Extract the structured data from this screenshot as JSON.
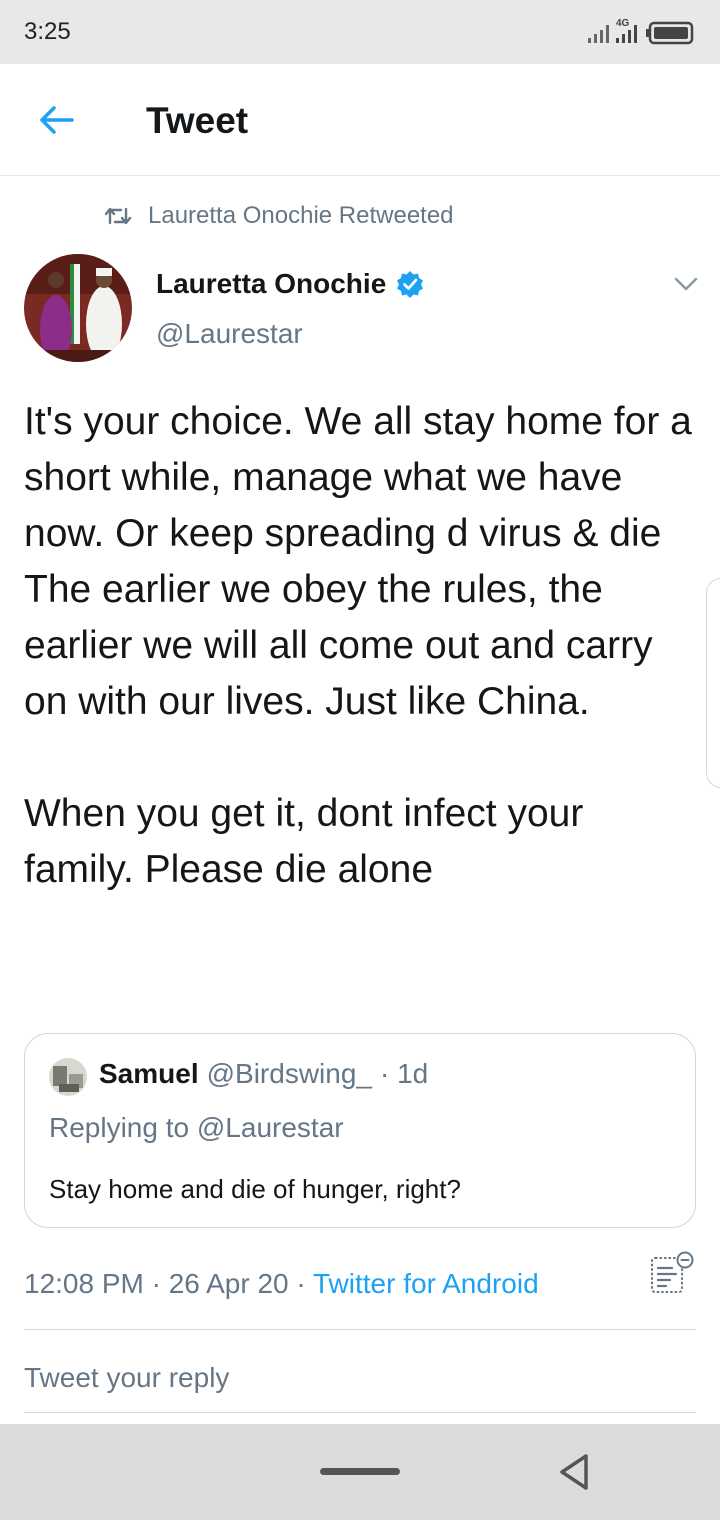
{
  "status_bar": {
    "time": "3:25",
    "network": "4G",
    "icons": [
      "signal-icon",
      "4g-signal-icon",
      "battery-icon"
    ]
  },
  "header": {
    "title": "Tweet",
    "back_icon": "arrow-left-icon"
  },
  "retweet": {
    "icon": "retweet-icon",
    "label": "Lauretta Onochie Retweeted"
  },
  "author": {
    "name": "Lauretta Onochie",
    "handle": "@Laurestar",
    "verified": true
  },
  "tweet": {
    "text": "It's your choice. We all stay home for a short while, manage what we have now. Or keep spreading d virus & die\nThe earlier we obey the rules, the earlier we will all come out and carry on with our lives. Just like China.\n\nWhen you get it, dont infect your family. Please die alone"
  },
  "quoted_tweet": {
    "name": "Samuel",
    "handle": "@Birdswing_",
    "age": "· 1d",
    "replying_prefix": "Replying to",
    "replying_mention": "@Laurestar",
    "text": "Stay home and die of hunger, right?"
  },
  "meta": {
    "time_date": "12:08 PM · 26 Apr 20 · ",
    "source": "Twitter for Android"
  },
  "reply": {
    "placeholder": "Tweet your reply"
  },
  "colors": {
    "accent": "#1da1f2",
    "secondary_text": "#657786",
    "border": "#ccd6dd"
  }
}
